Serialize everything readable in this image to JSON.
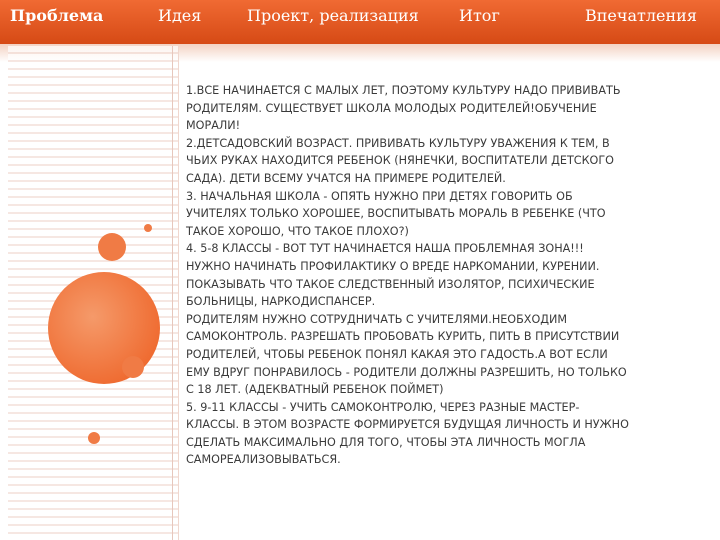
{
  "nav": {
    "items": [
      "Проблема",
      "Идея",
      "Проект, реализация",
      "Итог",
      "Впечатления"
    ]
  },
  "content": {
    "lines": [
      "1.ВСЕ НАЧИНАЕТСЯ С МАЛЫХ ЛЕТ, ПОЭТОМУ КУЛЬТУРУ НАДО ПРИВИВАТЬ",
      "РОДИТЕЛЯМ. СУЩЕСТВУЕТ ШКОЛА МОЛОДЫХ РОДИТЕЛЕЙ!ОБУЧЕНИЕ",
      "МОРАЛИ!",
      "2.ДЕТСАДОВСКИЙ ВОЗРАСТ. ПРИВИВАТЬ КУЛЬТУРУ УВАЖЕНИЯ К ТЕМ, В",
      "ЧЬИХ РУКАХ НАХОДИТСЯ РЕБЕНОК (НЯНЕЧКИ, ВОСПИТАТЕЛИ ДЕТСКОГО",
      "САДА). ДЕТИ ВСЕМУ УЧАТСЯ НА ПРИМЕРЕ РОДИТЕЛЕЙ.",
      "3. НАЧАЛЬНАЯ ШКОЛА - ОПЯТЬ НУЖНО ПРИ ДЕТЯХ ГОВОРИТЬ ОБ",
      "УЧИТЕЛЯХ ТОЛЬКО ХОРОШЕЕ, ВОСПИТЫВАТЬ МОРАЛЬ В РЕБЕНКЕ (ЧТО",
      "ТАКОЕ ХОРОШО, ЧТО ТАКОЕ ПЛОХО?)",
      "4. 5-8 КЛАССЫ - ВОТ ТУТ НАЧИНАЕТСЯ НАША ПРОБЛЕМНАЯ ЗОНА!!!",
      "НУЖНО НАЧИНАТЬ ПРОФИЛАКТИКУ О ВРЕДЕ НАРКОМАНИИ, КУРЕНИИ.",
      "ПОКАЗЫВАТЬ ЧТО ТАКОЕ СЛЕДСТВЕННЫЙ ИЗОЛЯТОР, ПСИХИЧЕСКИЕ",
      "БОЛЬНИЦЫ, НАРКОДИСПАНСЕР.",
      "РОДИТЕЛЯМ НУЖНО СОТРУДНИЧАТЬ С УЧИТЕЛЯМИ.НЕОБХОДИМ",
      "САМОКОНТРОЛЬ. РАЗРЕШАТЬ ПРОБОВАТЬ КУРИТЬ, ПИТЬ В ПРИСУТСТВИИ",
      "РОДИТЕЛЕЙ, ЧТОБЫ РЕБЕНОК ПОНЯЛ КАКАЯ ЭТО ГАДОСТЬ.А ВОТ ЕСЛИ",
      "ЕМУ ВДРУГ ПОНРАВИЛОСЬ - РОДИТЕЛИ ДОЛЖНЫ РАЗРЕШИТЬ, НО ТОЛЬКО",
      "С 18 ЛЕТ. (АДЕКВАТНЫЙ РЕБЕНОК ПОЙМЕТ)",
      "5. 9-11 КЛАССЫ - УЧИТЬ САМОКОНТРОЛЮ, ЧЕРЕЗ РАЗНЫЕ МАСТЕР-",
      "КЛАССЫ. В ЭТОМ ВОЗРАСТЕ ФОРМИРУЕТСЯ БУДУЩАЯ ЛИЧНОСТЬ И НУЖНО",
      "СДЕЛАТЬ МАКСИМАЛЬНО ДЛЯ ТОГО, ЧТОБЫ ЭТА ЛИЧНОСТЬ МОГЛА",
      "САМОРЕАЛИЗОВЫВАТЬСЯ."
    ]
  },
  "colors": {
    "accent": "#e8561c",
    "circle": "#f07b45",
    "text": "#3a3a3a"
  }
}
